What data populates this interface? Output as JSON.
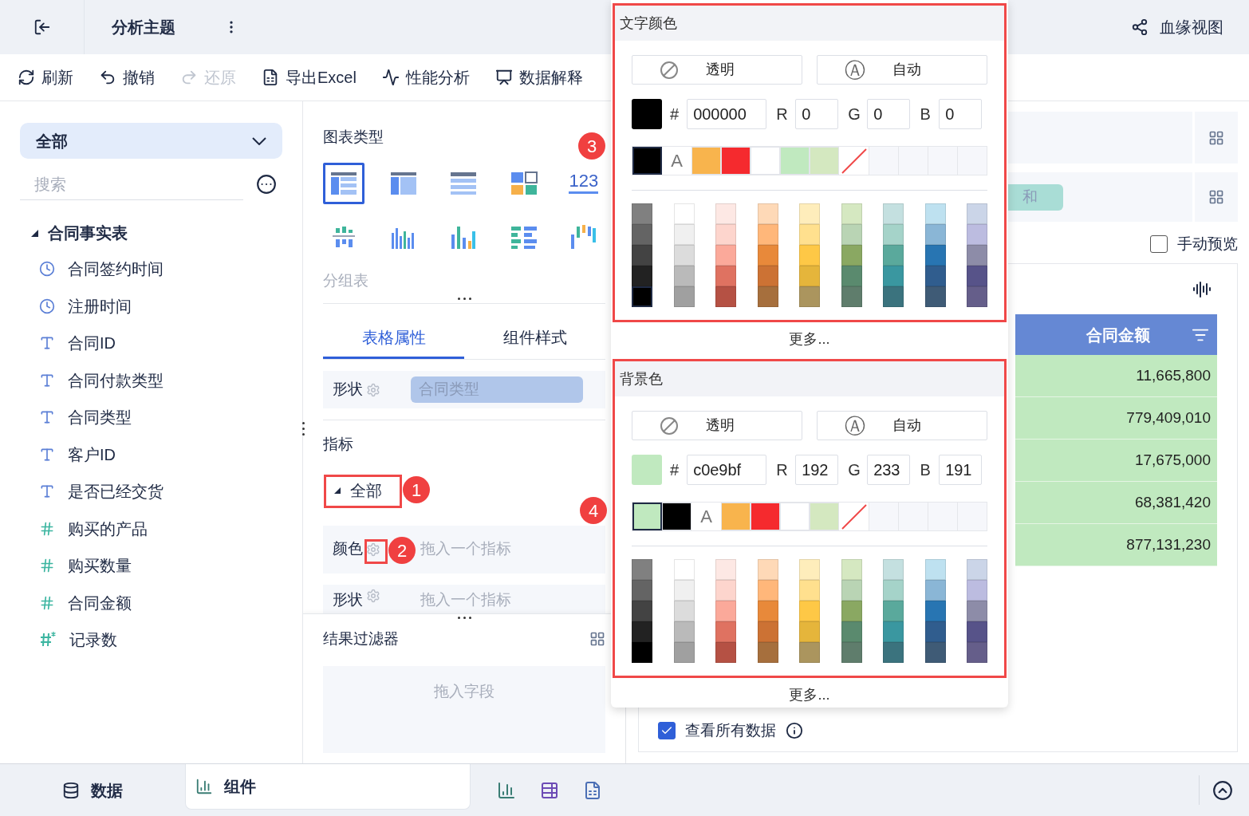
{
  "topbar": {
    "title": "分析主题",
    "lineage": "血缘视图"
  },
  "toolbar": [
    {
      "label": "刷新",
      "kind": "refresh",
      "disabled": false
    },
    {
      "label": "撤销",
      "kind": "undo",
      "disabled": false
    },
    {
      "label": "还原",
      "kind": "redo",
      "disabled": true
    },
    {
      "label": "导出Excel",
      "kind": "excel",
      "disabled": false
    },
    {
      "label": "性能分析",
      "kind": "perf",
      "disabled": false
    },
    {
      "label": "数据解释",
      "kind": "explain",
      "disabled": false
    }
  ],
  "fields_panel": {
    "scope": "全部",
    "search_placeholder": "搜索",
    "tree": [
      {
        "label": "合同事实表",
        "expanded": true,
        "children": [
          {
            "label": "合同签约时间",
            "kind": "time"
          },
          {
            "label": "注册时间",
            "kind": "time"
          },
          {
            "label": "合同ID",
            "kind": "text"
          },
          {
            "label": "合同付款类型",
            "kind": "text"
          },
          {
            "label": "合同类型",
            "kind": "text"
          },
          {
            "label": "客户ID",
            "kind": "text"
          },
          {
            "label": "是否已经交货",
            "kind": "text"
          },
          {
            "label": "购买的产品",
            "kind": "number"
          },
          {
            "label": "购买数量",
            "kind": "number"
          },
          {
            "label": "合同金额",
            "kind": "number"
          },
          {
            "label": "记录数",
            "kind": "count"
          }
        ]
      }
    ]
  },
  "chart_panel": {
    "title": "图表类型",
    "types": [
      {
        "kind": "table",
        "selected": true
      },
      {
        "kind": "crosstab",
        "selected": false
      },
      {
        "kind": "detail",
        "selected": false
      },
      {
        "kind": "kpi",
        "selected": false
      },
      {
        "kind": "number",
        "label": "123",
        "selected": false
      },
      {
        "kind": "bar-grouped",
        "selected": false
      },
      {
        "kind": "bar-multi",
        "selected": false
      },
      {
        "kind": "bar-color",
        "selected": false
      },
      {
        "kind": "bar-h",
        "selected": false
      },
      {
        "kind": "waterfall",
        "selected": false
      }
    ],
    "type_name": "分组表",
    "tabs": [
      {
        "label": "表格属性",
        "selected": true
      },
      {
        "label": "组件样式",
        "selected": false
      }
    ],
    "shape_row": {
      "label": "形状",
      "value": "合同类型"
    },
    "measures_title": "指标",
    "measure_group": {
      "label": "全部",
      "expanded": true
    },
    "slots": [
      {
        "label": "颜色",
        "hint": "拖入一个指标"
      },
      {
        "label": "形状",
        "hint": "拖入一个指标"
      }
    ],
    "filter_title": "结果过滤器",
    "filter_hint": "拖入字段"
  },
  "preview": {
    "pill": "和",
    "manual_preview": {
      "label": "手动预览",
      "checked": false
    },
    "table": {
      "column": "合同金额",
      "rows": [
        "11,665,800",
        "779,409,010",
        "17,675,000",
        "68,381,420",
        "877,131,230"
      ]
    },
    "show_all": {
      "label": "查看所有数据",
      "checked": true
    }
  },
  "color_popup": {
    "sections": [
      {
        "title": "文字颜色",
        "buttons": [
          {
            "label": "透明",
            "kind": "transparent"
          },
          {
            "label": "自动",
            "kind": "auto",
            "icon": "Ⓐ"
          }
        ],
        "current": {
          "color": "#000000"
        },
        "hash": "#",
        "hex": "000000",
        "channels": [
          {
            "label": "R",
            "value": "0"
          },
          {
            "label": "G",
            "value": "0"
          },
          {
            "label": "B",
            "value": "0"
          }
        ],
        "recent": [
          {
            "kind": "color",
            "color": "#000000",
            "selected": true
          },
          {
            "kind": "auto",
            "label": "A",
            "selected": false
          },
          {
            "kind": "color",
            "color": "#f8b44d",
            "selected": false
          },
          {
            "kind": "color",
            "color": "#f52a2e",
            "selected": false
          },
          {
            "kind": "color",
            "color": "#ffffff",
            "selected": false
          },
          {
            "kind": "color",
            "color": "#c0e9bf",
            "selected": false
          },
          {
            "kind": "color",
            "color": "#d4e8c0",
            "selected": false
          },
          {
            "kind": "none",
            "selected": false
          },
          {
            "kind": "empty",
            "selected": false
          },
          {
            "kind": "empty",
            "selected": false
          },
          {
            "kind": "empty",
            "selected": false
          },
          {
            "kind": "empty",
            "selected": false
          }
        ],
        "palette": [
          [
            {
              "color": "#808080",
              "selected": false
            },
            {
              "color": "#646464",
              "selected": false
            },
            {
              "color": "#434343",
              "selected": false
            },
            {
              "color": "#222222",
              "selected": false
            },
            {
              "color": "#000000",
              "selected": true
            }
          ],
          [
            {
              "color": "#ffffff",
              "selected": false
            },
            {
              "color": "#f0f0f0",
              "selected": false
            },
            {
              "color": "#dcdcdc",
              "selected": false
            },
            {
              "color": "#bababa",
              "selected": false
            },
            {
              "color": "#a0a0a0",
              "selected": false
            }
          ],
          [
            {
              "color": "#fde8e4",
              "selected": false
            },
            {
              "color": "#fdd5cd",
              "selected": false
            },
            {
              "color": "#fba99a",
              "selected": false
            },
            {
              "color": "#df7261",
              "selected": false
            },
            {
              "color": "#b55144",
              "selected": false
            }
          ],
          [
            {
              "color": "#fed9b7",
              "selected": false
            },
            {
              "color": "#ffb77a",
              "selected": false
            },
            {
              "color": "#e8893a",
              "selected": false
            },
            {
              "color": "#cc7234",
              "selected": false
            },
            {
              "color": "#a66f3d",
              "selected": false
            }
          ],
          [
            {
              "color": "#feedbb",
              "selected": false
            },
            {
              "color": "#ffe08e",
              "selected": false
            },
            {
              "color": "#fec846",
              "selected": false
            },
            {
              "color": "#e5b53b",
              "selected": false
            },
            {
              "color": "#ab955e",
              "selected": false
            }
          ],
          [
            {
              "color": "#d5e8c1",
              "selected": false
            },
            {
              "color": "#b9d4b4",
              "selected": false
            },
            {
              "color": "#8aa862",
              "selected": false
            },
            {
              "color": "#5a8a6e",
              "selected": false
            },
            {
              "color": "#5f7d6c",
              "selected": false
            }
          ],
          [
            {
              "color": "#c4e0e0",
              "selected": false
            },
            {
              "color": "#a5d3c9",
              "selected": false
            },
            {
              "color": "#5aa99c",
              "selected": false
            },
            {
              "color": "#3a97a0",
              "selected": false
            },
            {
              "color": "#3b737e",
              "selected": false
            }
          ],
          [
            {
              "color": "#bee1f0",
              "selected": false
            },
            {
              "color": "#8ab6d6",
              "selected": false
            },
            {
              "color": "#2875b2",
              "selected": false
            },
            {
              "color": "#305d8e",
              "selected": false
            },
            {
              "color": "#3f5b76",
              "selected": false
            }
          ],
          [
            {
              "color": "#cbd5e8",
              "selected": false
            },
            {
              "color": "#bcbce0",
              "selected": false
            },
            {
              "color": "#8d8ca8",
              "selected": false
            },
            {
              "color": "#575389",
              "selected": false
            },
            {
              "color": "#655e8a",
              "selected": false
            }
          ]
        ],
        "more": "更多..."
      },
      {
        "title": "背景色",
        "buttons": [
          {
            "label": "透明",
            "kind": "transparent"
          },
          {
            "label": "自动",
            "kind": "auto",
            "icon": "Ⓐ"
          }
        ],
        "current": {
          "color": "#c0e9bf"
        },
        "hash": "#",
        "hex": "c0e9bf",
        "channels": [
          {
            "label": "R",
            "value": "192"
          },
          {
            "label": "G",
            "value": "233"
          },
          {
            "label": "B",
            "value": "191"
          }
        ],
        "recent": [
          {
            "kind": "color",
            "color": "#c0e9bf",
            "selected": true
          },
          {
            "kind": "color",
            "color": "#000000",
            "selected": false
          },
          {
            "kind": "auto",
            "label": "A",
            "selected": false
          },
          {
            "kind": "color",
            "color": "#f8b44d",
            "selected": false
          },
          {
            "kind": "color",
            "color": "#f52a2e",
            "selected": false
          },
          {
            "kind": "color",
            "color": "#ffffff",
            "selected": false
          },
          {
            "kind": "color",
            "color": "#d4e8c0",
            "selected": false
          },
          {
            "kind": "none",
            "selected": false
          },
          {
            "kind": "empty",
            "selected": false
          },
          {
            "kind": "empty",
            "selected": false
          },
          {
            "kind": "empty",
            "selected": false
          },
          {
            "kind": "empty",
            "selected": false
          }
        ],
        "palette": [
          [
            {
              "color": "#808080",
              "selected": false
            },
            {
              "color": "#646464",
              "selected": false
            },
            {
              "color": "#434343",
              "selected": false
            },
            {
              "color": "#222222",
              "selected": false
            },
            {
              "color": "#000000",
              "selected": false
            }
          ],
          [
            {
              "color": "#ffffff",
              "selected": false
            },
            {
              "color": "#f0f0f0",
              "selected": false
            },
            {
              "color": "#dcdcdc",
              "selected": false
            },
            {
              "color": "#bababa",
              "selected": false
            },
            {
              "color": "#a0a0a0",
              "selected": false
            }
          ],
          [
            {
              "color": "#fde8e4",
              "selected": false
            },
            {
              "color": "#fdd5cd",
              "selected": false
            },
            {
              "color": "#fba99a",
              "selected": false
            },
            {
              "color": "#df7261",
              "selected": false
            },
            {
              "color": "#b55144",
              "selected": false
            }
          ],
          [
            {
              "color": "#fed9b7",
              "selected": false
            },
            {
              "color": "#ffb77a",
              "selected": false
            },
            {
              "color": "#e8893a",
              "selected": false
            },
            {
              "color": "#cc7234",
              "selected": false
            },
            {
              "color": "#a66f3d",
              "selected": false
            }
          ],
          [
            {
              "color": "#feedbb",
              "selected": false
            },
            {
              "color": "#ffe08e",
              "selected": false
            },
            {
              "color": "#fec846",
              "selected": false
            },
            {
              "color": "#e5b53b",
              "selected": false
            },
            {
              "color": "#ab955e",
              "selected": false
            }
          ],
          [
            {
              "color": "#d5e8c1",
              "selected": false
            },
            {
              "color": "#b9d4b4",
              "selected": false
            },
            {
              "color": "#8aa862",
              "selected": false
            },
            {
              "color": "#5a8a6e",
              "selected": false
            },
            {
              "color": "#5f7d6c",
              "selected": false
            }
          ],
          [
            {
              "color": "#c4e0e0",
              "selected": false
            },
            {
              "color": "#a5d3c9",
              "selected": false
            },
            {
              "color": "#5aa99c",
              "selected": false
            },
            {
              "color": "#3a97a0",
              "selected": false
            },
            {
              "color": "#3b737e",
              "selected": false
            }
          ],
          [
            {
              "color": "#bee1f0",
              "selected": false
            },
            {
              "color": "#8ab6d6",
              "selected": false
            },
            {
              "color": "#2875b2",
              "selected": false
            },
            {
              "color": "#305d8e",
              "selected": false
            },
            {
              "color": "#3f5b76",
              "selected": false
            }
          ],
          [
            {
              "color": "#cbd5e8",
              "selected": false
            },
            {
              "color": "#bcbce0",
              "selected": false
            },
            {
              "color": "#8d8ca8",
              "selected": false
            },
            {
              "color": "#575389",
              "selected": false
            },
            {
              "color": "#655e8a",
              "selected": false
            }
          ]
        ],
        "more": "更多..."
      }
    ]
  },
  "annotations": [
    "1",
    "2",
    "3",
    "4"
  ],
  "bottom_tabs": [
    {
      "label": "数据",
      "kind": "data",
      "selected": false
    },
    {
      "label": "组件",
      "kind": "component",
      "selected": true
    }
  ]
}
